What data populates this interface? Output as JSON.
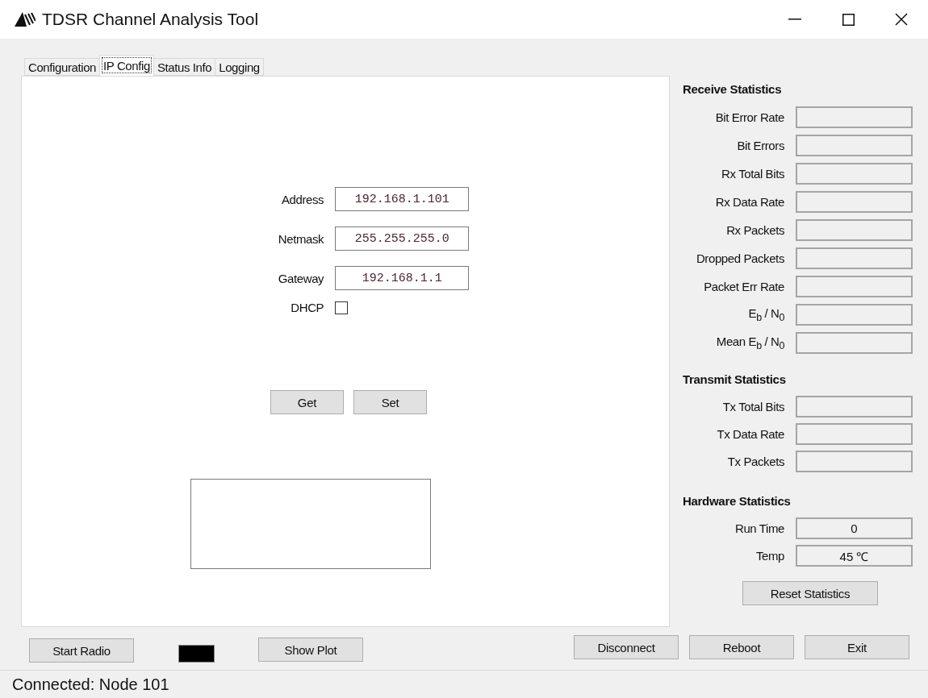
{
  "window": {
    "title": "TDSR Channel Analysis Tool"
  },
  "tabs": [
    {
      "label": "Configuration",
      "selected": false
    },
    {
      "label": "IP Config",
      "selected": true
    },
    {
      "label": "Status Info",
      "selected": false
    },
    {
      "label": "Logging",
      "selected": false
    }
  ],
  "ip_config": {
    "fields": [
      {
        "label": "Address",
        "value": "192.168.1.101"
      },
      {
        "label": "Netmask",
        "value": "255.255.255.0"
      },
      {
        "label": "Gateway",
        "value": "192.168.1.1"
      }
    ],
    "dhcp": {
      "label": "DHCP",
      "checked": false
    },
    "buttons": [
      "Get",
      "Set"
    ]
  },
  "statistics": [
    {
      "title": "Receive Statistics",
      "rows": [
        {
          "label": "Bit Error Rate"
        },
        {
          "label": "Bit Errors"
        },
        {
          "label": "Rx Total Bits"
        },
        {
          "label": "Rx Data Rate"
        },
        {
          "label": "Rx Packets"
        },
        {
          "label": "Dropped Packets"
        },
        {
          "label": "Packet Err Rate"
        },
        {
          "label": "E$_{b}$ / N$_{0}$"
        },
        {
          "label": "Mean E$_{b}$ / N$_{0}$"
        }
      ]
    },
    {
      "title": "Transmit Statistics",
      "rows": [
        {
          "label": "Tx Total Bits"
        },
        {
          "label": "Tx Data Rate"
        },
        {
          "label": "Tx Packets"
        }
      ]
    },
    {
      "title": "Hardware Statistics",
      "rows": [
        {
          "label": "Run Time",
          "value": "0"
        },
        {
          "label": "Temp",
          "value": "45 ℃"
        }
      ]
    }
  ],
  "reset_button": "Reset Statistics",
  "bottom_left": {
    "start_button": "Start Radio",
    "radio_running": false,
    "plot_button": "Show Plot"
  },
  "bottom_right": [
    "Disconnect",
    "Reboot",
    "Exit"
  ],
  "status_bar": "Connected: Node 101"
}
